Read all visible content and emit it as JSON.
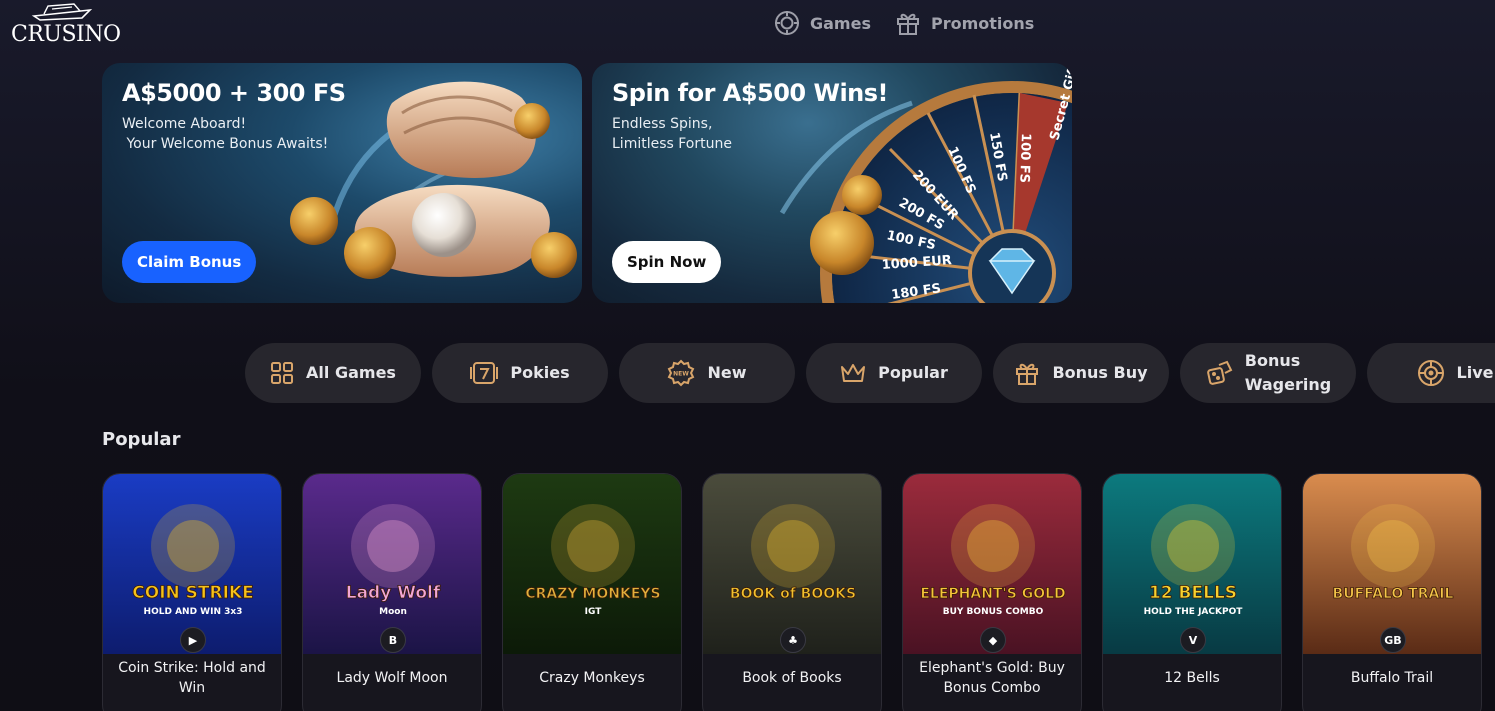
{
  "brand": {
    "logo_text": "CRUSINO"
  },
  "topnav": [
    {
      "label": "Games",
      "icon": "target-icon"
    },
    {
      "label": "Promotions",
      "icon": "gift-icon"
    }
  ],
  "banners": [
    {
      "title": "A$5000 + 300 FS",
      "subtitle": "Welcome Aboard!\n Your Welcome Bonus Awaits!",
      "cta": "Claim Bonus",
      "cta_color": "#1862ff"
    },
    {
      "title": "Spin for A$500 Wins!",
      "subtitle": "Endless Spins,\nLimitless Fortune",
      "cta": "Spin Now",
      "cta_color": "#ffffff",
      "wheel_labels": [
        "180 FS",
        "1000 EUR",
        "100 FS",
        "200 FS",
        "200 EUR",
        "100 FS",
        "150 FS",
        "100 FS",
        "Secret Gift"
      ]
    }
  ],
  "categories": [
    {
      "label": "All Games",
      "icon": "grid-icon"
    },
    {
      "label": "Pokies",
      "icon": "seven-icon"
    },
    {
      "label": "New",
      "icon": "new-badge-icon",
      "icon_text": "NEW"
    },
    {
      "label": "Popular",
      "icon": "crown-icon"
    },
    {
      "label": "Bonus Buy",
      "icon": "gift-icon"
    },
    {
      "label": "Bonus\nWagering",
      "icon": "dice-icon"
    },
    {
      "label": "Live",
      "icon": "roulette-icon"
    }
  ],
  "popular": {
    "title": "Popular",
    "games": [
      {
        "name": "Coin Strike: Hold and Win",
        "art_text": "COIN STRIKE",
        "art_sub": "HOLD AND WIN 3x3",
        "provider": "▶",
        "bg": [
          "#1a3cc4",
          "#0d1c6e"
        ],
        "accent": "#f6c21a"
      },
      {
        "name": "Lady Wolf Moon",
        "art_text": "Lady Wolf",
        "art_sub": "Moon",
        "provider": "B",
        "bg": [
          "#5a2a8c",
          "#1b1446"
        ],
        "accent": "#f3a7d6"
      },
      {
        "name": "Crazy Monkeys",
        "art_text": "CRAZY MONKEYS",
        "art_sub": "IGT",
        "provider": "",
        "bg": [
          "#1e3a12",
          "#0c1a08"
        ],
        "accent": "#e2b13c"
      },
      {
        "name": "Book of Books",
        "art_text": "BOOK of BOOKS",
        "art_sub": "",
        "provider": "♣",
        "bg": [
          "#4b4c3c",
          "#1f211b"
        ],
        "accent": "#f2c12e"
      },
      {
        "name": "Elephant's Gold: Buy Bonus Combo",
        "art_text": "ELEPHANT'S GOLD",
        "art_sub": "BUY BONUS COMBO",
        "provider": "◆",
        "bg": [
          "#9b2b3c",
          "#4a1223"
        ],
        "accent": "#f6c53a"
      },
      {
        "name": "12 Bells",
        "art_text": "12 BELLS",
        "art_sub": "HOLD THE JACKPOT",
        "provider": "V",
        "bg": [
          "#0c7a7e",
          "#083a43"
        ],
        "accent": "#f7d22f"
      },
      {
        "name": "Buffalo Trail",
        "art_text": "BUFFALO TRAIL",
        "art_sub": "",
        "provider": "GB",
        "bg": [
          "#d98c4e",
          "#5a2b16"
        ],
        "accent": "#f5c64a"
      }
    ]
  }
}
